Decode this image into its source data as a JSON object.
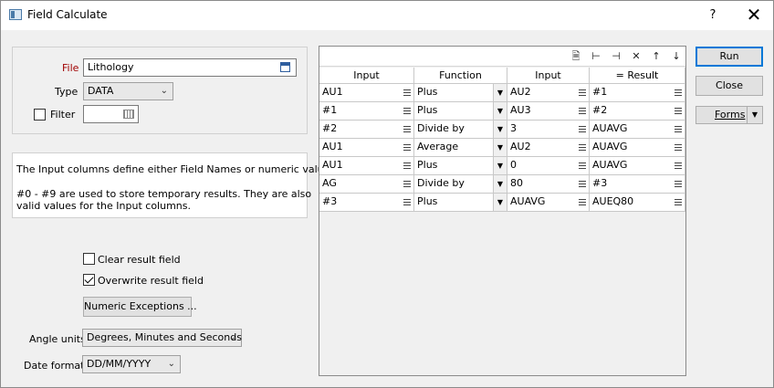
{
  "window": {
    "title": "Field Calculate",
    "help_label": "?",
    "close_label": "✕"
  },
  "form": {
    "file_label": "File",
    "file_value": "Lithology",
    "type_label": "Type",
    "type_value": "DATA",
    "filter_label": "Filter",
    "filter_value": ""
  },
  "info": {
    "line1": "The Input columns define either Field Names or numeric values.",
    "line2": "#0 - #9 are used to store temporary results.  They are also",
    "line3": "valid values for the Input columns."
  },
  "options": {
    "clear_label": "Clear result field",
    "clear_checked": false,
    "overwrite_label": "Overwrite result field",
    "overwrite_checked": true,
    "numeric_exceptions_label": "Numeric Exceptions ...",
    "angle_label": "Angle units",
    "angle_value": "Degrees, Minutes and Seconds",
    "date_label": "Date format",
    "date_value": "DD/MM/YYYY"
  },
  "grid": {
    "headers": [
      "Input",
      "Function",
      "Input",
      "= Result"
    ],
    "rows": [
      [
        "AU1",
        "Plus",
        "AU2",
        "#1"
      ],
      [
        "#1",
        "Plus",
        "AU3",
        "#2"
      ],
      [
        "#2",
        "Divide by",
        "3",
        "AUAVG"
      ],
      [
        "AU1",
        "Average",
        "AU2",
        "AUAVG"
      ],
      [
        "AU1",
        "Plus",
        "0",
        "AUAVG"
      ],
      [
        "AG",
        "Divide by",
        "80",
        "#3"
      ],
      [
        "#3",
        "Plus",
        "AUAVG",
        "AUEQ80"
      ]
    ]
  },
  "buttons": {
    "run": "Run",
    "close": "Close",
    "forms": "Forms"
  }
}
